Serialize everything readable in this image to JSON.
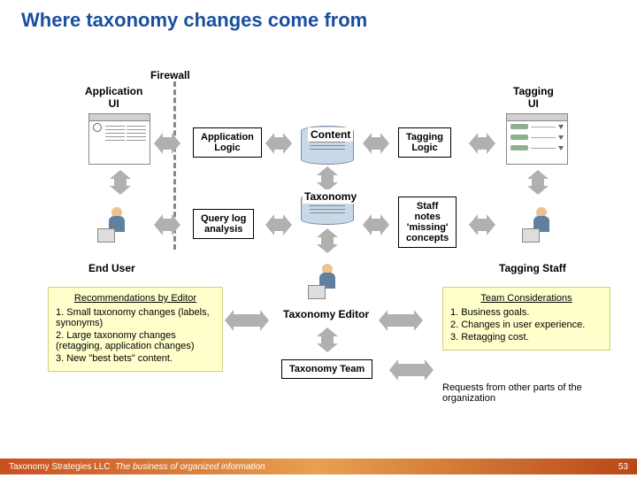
{
  "title": "Where taxonomy changes come from",
  "labels": {
    "firewall": "Firewall",
    "app_ui": "Application\nUI",
    "tag_ui": "Tagging\nUI",
    "app_logic": "Application\nLogic",
    "content": "Content",
    "tag_logic": "Tagging\nLogic",
    "taxonomy": "Taxonomy",
    "query_log": "Query log\nanalysis",
    "staff_notes": "Staff\nnotes\n'missing'\nconcepts",
    "end_user": "End User",
    "tag_staff": "Tagging Staff",
    "tax_editor": "Taxonomy Editor",
    "tax_team": "Taxonomy Team"
  },
  "recs": {
    "heading": "Recommendations by Editor",
    "i1": "1. Small taxonomy changes (labels, synonyms)",
    "i2": "2. Large taxonomy changes (retagging, application changes)",
    "i3": "3. New \"best bets\" content."
  },
  "team": {
    "heading": "Team Considerations",
    "i1": "1. Business goals.",
    "i2": "2. Changes in user experience.",
    "i3": "3. Retagging cost."
  },
  "requests": "Requests from other parts of the organization",
  "footer": {
    "company": "Taxonomy Strategies LLC",
    "tagline": "The business of organized information",
    "page": "53"
  }
}
